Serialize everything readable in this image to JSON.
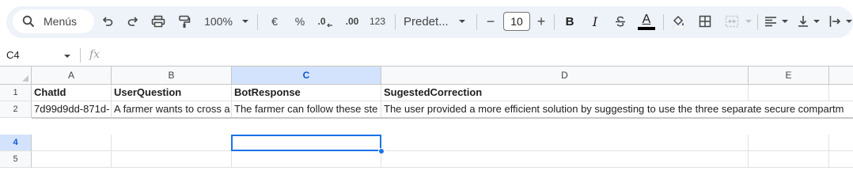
{
  "toolbar": {
    "search_placeholder": "Menús",
    "zoom": "100%",
    "currency_symbol": "€",
    "percent_symbol": "%",
    "decrease_decimals_label": ".0",
    "increase_decimals_label": ".00",
    "number_format_label": "123",
    "font_family": "Predet...",
    "font_size": "10",
    "minus_label": "−",
    "plus_label": "+",
    "bold_label": "B",
    "italic_label": "I",
    "text_color_label": "A",
    "text_color": "#000000"
  },
  "formula_bar": {
    "name_box": "C4",
    "fx_label": "fx"
  },
  "grid": {
    "columns": [
      "A",
      "B",
      "C",
      "D",
      "E"
    ],
    "selected_column": "C",
    "rows": [
      "1",
      "2",
      "4",
      "5"
    ],
    "selected_row": "4",
    "row1": {
      "a": "ChatId",
      "b": "UserQuestion",
      "c": "BotResponse",
      "d": "SugestedCorrection"
    },
    "row2": {
      "a": "7d99d9dd-871d-",
      "b": "A farmer wants to cross a",
      "c": "The farmer can follow these ste",
      "d": "The user provided a more efficient solution by suggesting to use the three separate secure compartm"
    }
  },
  "colors": {
    "accent": "#1a73e8",
    "selected_header_bg": "#d3e3fd",
    "toolbar_bg": "#eef2f9"
  }
}
